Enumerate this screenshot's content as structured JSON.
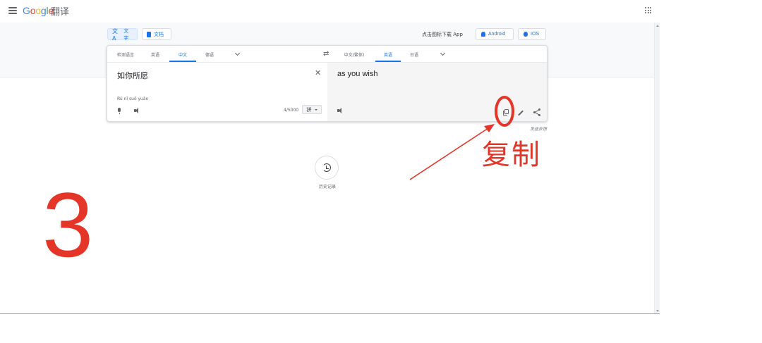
{
  "header": {
    "logo_letters": [
      "G",
      "o",
      "o",
      "g",
      "l",
      "e"
    ],
    "logo_colors": [
      "#4285f4",
      "#ea4335",
      "#fbbc05",
      "#4285f4",
      "#34a853",
      "#ea4335"
    ],
    "product_name": "翻译"
  },
  "mode_tabs": [
    {
      "label": "文字",
      "icon": "text-translate-icon",
      "active": true
    },
    {
      "label": "文档",
      "icon": "document-icon",
      "active": false
    }
  ],
  "app_promo": {
    "text": "点击图标下载 App",
    "android_label": "Android",
    "ios_label": "IOS"
  },
  "source_langs": [
    {
      "label": "检测语言",
      "active": false
    },
    {
      "label": "英语",
      "active": false
    },
    {
      "label": "中文",
      "active": true
    },
    {
      "label": "德语",
      "active": false
    }
  ],
  "target_langs": [
    {
      "label": "中文(繁体)",
      "active": false
    },
    {
      "label": "英语",
      "active": true
    },
    {
      "label": "日语",
      "active": false
    }
  ],
  "source": {
    "text": "如你所愿",
    "pinyin": "Rú nǐ suǒ yuàn",
    "char_count": "4/5000",
    "ime_label": "拼"
  },
  "target": {
    "text": "as you wish"
  },
  "feedback_label": "发送反馈",
  "history_label": "历史记录",
  "annotation": {
    "step_number": "3",
    "label": "复制",
    "color": "#e53528"
  },
  "colors": {
    "accent": "#1a73e8",
    "annotation_red": "#e53528"
  }
}
